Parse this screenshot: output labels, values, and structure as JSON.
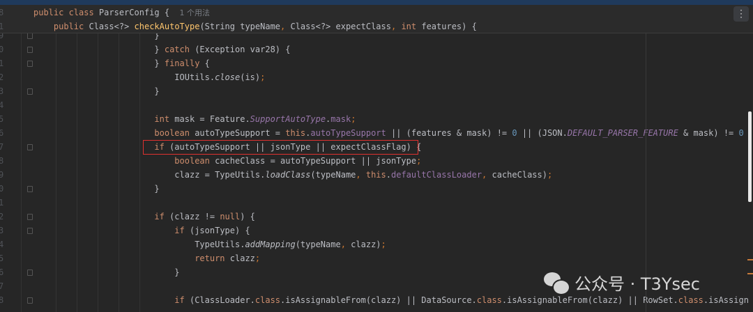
{
  "editor": {
    "menu_icon": "more-vertical-icon",
    "sticky": [
      {
        "ln": "8",
        "tokens": [
          [
            "public class ",
            "k"
          ],
          [
            "ParserConfig {  ",
            ""
          ],
          [
            "1 个用法",
            "hint"
          ]
        ]
      },
      {
        "ln": "1",
        "tokens": [
          [
            "    public ",
            "k"
          ],
          [
            "Class<?> ",
            ""
          ],
          [
            "checkAutoType",
            "m"
          ],
          [
            "(String typeName",
            ""
          ],
          [
            ", ",
            "p"
          ],
          [
            "Class<?> expectClass",
            ""
          ],
          [
            ", ",
            "p"
          ],
          [
            "int ",
            "k"
          ],
          [
            "features) {",
            ""
          ]
        ]
      }
    ],
    "lines": [
      {
        "ln": "9",
        "fold": true,
        "tokens": [
          [
            "                        }",
            ""
          ]
        ]
      },
      {
        "ln": "0",
        "fold": true,
        "tokens": [
          [
            "                        } ",
            ""
          ],
          [
            "catch ",
            "k"
          ],
          [
            "(Exception var28) {",
            ""
          ]
        ]
      },
      {
        "ln": "1",
        "fold": true,
        "tokens": [
          [
            "                        } ",
            ""
          ],
          [
            "finally ",
            "k"
          ],
          [
            "{",
            ""
          ]
        ]
      },
      {
        "ln": "2",
        "tokens": [
          [
            "                            IOUtils.",
            ""
          ],
          [
            "close",
            "i"
          ],
          [
            "(is)",
            ""
          ],
          [
            ";",
            "p"
          ]
        ]
      },
      {
        "ln": "3",
        "fold": true,
        "tokens": [
          [
            "                        }",
            ""
          ]
        ]
      },
      {
        "ln": "4",
        "tokens": []
      },
      {
        "ln": "5",
        "tokens": [
          [
            "                        int ",
            "k"
          ],
          [
            "mask = Feature.",
            ""
          ],
          [
            "SupportAutoType",
            "fi"
          ],
          [
            ".",
            ""
          ],
          [
            "mask",
            "f"
          ],
          [
            ";",
            "p"
          ]
        ]
      },
      {
        "ln": "6",
        "tokens": [
          [
            "                        boolean ",
            "k"
          ],
          [
            "autoTypeSupport = ",
            ""
          ],
          [
            "this",
            "k"
          ],
          [
            ".",
            ""
          ],
          [
            "autoTypeSupport",
            "f"
          ],
          [
            " || (features & mask) != ",
            ""
          ],
          [
            "0",
            "n"
          ],
          [
            " || (JSON.",
            ""
          ],
          [
            "DEFAULT_PARSER_FEATURE",
            "fi"
          ],
          [
            " & mask) != ",
            ""
          ],
          [
            "0",
            "n"
          ]
        ]
      },
      {
        "ln": "7",
        "fold": true,
        "tokens": [
          [
            "                        if ",
            "k"
          ],
          [
            "(autoTypeSupport || jsonType || expectClassFlag) {",
            ""
          ]
        ]
      },
      {
        "ln": "8",
        "tokens": [
          [
            "                            boolean ",
            "k"
          ],
          [
            "cacheClass = autoTypeSupport || jsonType",
            ""
          ],
          [
            ";",
            "p"
          ]
        ]
      },
      {
        "ln": "9",
        "tokens": [
          [
            "                            clazz = TypeUtils.",
            ""
          ],
          [
            "loadClass",
            "i"
          ],
          [
            "(typeName",
            ""
          ],
          [
            ", ",
            "p"
          ],
          [
            "this",
            "k"
          ],
          [
            ".",
            ""
          ],
          [
            "defaultClassLoader",
            "f"
          ],
          [
            ", ",
            "p"
          ],
          [
            "cacheClass)",
            ""
          ],
          [
            ";",
            "p"
          ]
        ]
      },
      {
        "ln": "0",
        "fold": true,
        "tokens": [
          [
            "                        }",
            ""
          ]
        ]
      },
      {
        "ln": "1",
        "tokens": []
      },
      {
        "ln": "2",
        "fold": true,
        "tokens": [
          [
            "                        if ",
            "k"
          ],
          [
            "(clazz != ",
            ""
          ],
          [
            "null",
            "k"
          ],
          [
            ") {",
            ""
          ]
        ]
      },
      {
        "ln": "3",
        "fold": true,
        "tokens": [
          [
            "                            if ",
            "k"
          ],
          [
            "(jsonType) {",
            ""
          ]
        ]
      },
      {
        "ln": "4",
        "tokens": [
          [
            "                                TypeUtils.",
            ""
          ],
          [
            "addMapping",
            "i"
          ],
          [
            "(typeName",
            ""
          ],
          [
            ", ",
            "p"
          ],
          [
            "clazz)",
            ""
          ],
          [
            ";",
            "p"
          ]
        ]
      },
      {
        "ln": "5",
        "tokens": [
          [
            "                                return ",
            "k"
          ],
          [
            "clazz",
            ""
          ],
          [
            ";",
            "p"
          ]
        ]
      },
      {
        "ln": "6",
        "fold": true,
        "tokens": [
          [
            "                            }",
            ""
          ]
        ]
      },
      {
        "ln": "7",
        "tokens": []
      },
      {
        "ln": "8",
        "fold": true,
        "tokens": [
          [
            "                            if ",
            "k"
          ],
          [
            "(ClassLoader.",
            ""
          ],
          [
            "class",
            "k"
          ],
          [
            ".isAssignableFrom(clazz) || DataSource.",
            ""
          ],
          [
            "class",
            "k"
          ],
          [
            ".isAssignableFrom(clazz) || RowSet.",
            ""
          ],
          [
            "class",
            "k"
          ],
          [
            ".isAssign",
            ""
          ]
        ]
      }
    ]
  },
  "watermark": {
    "label": "公众号 · T3Ysec",
    "icon": "wechat-icon"
  }
}
